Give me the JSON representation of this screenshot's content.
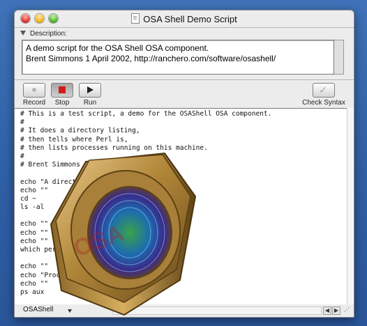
{
  "window": {
    "title": "OSA Shell Demo Script"
  },
  "description": {
    "label": "Description:",
    "lines": [
      "A demo script for the OSA Shell OSA component.",
      "Brent Simmons 1 April 2002, http://ranchero.com/software/osashell/"
    ]
  },
  "toolbar": {
    "record_label": "Record",
    "stop_label": "Stop",
    "run_label": "Run",
    "check_syntax_label": "Check Syntax"
  },
  "script_lines": [
    "# This is a test script, a demo for the OSAShell OSA component.",
    "#",
    "# It does a directory listing,",
    "# then tells where Perl is,",
    "# then lists processes running on this machine.",
    "#",
    "# Brent Simmons 1 April 2002",
    "",
    "echo \"A directory listing:\"",
    "echo \"\"",
    "cd ~",
    "ls -al",
    "",
    "echo \"\"",
    "echo \"\"",
    "echo \"\"",
    "which perl",
    "",
    "echo \"\"",
    "echo \"Processes running...\"",
    "echo \"\"",
    "ps aux"
  ],
  "status": {
    "language": "OSAShell"
  },
  "colors": {
    "stop": "#d21b1b",
    "desktop": "#3569b0"
  }
}
